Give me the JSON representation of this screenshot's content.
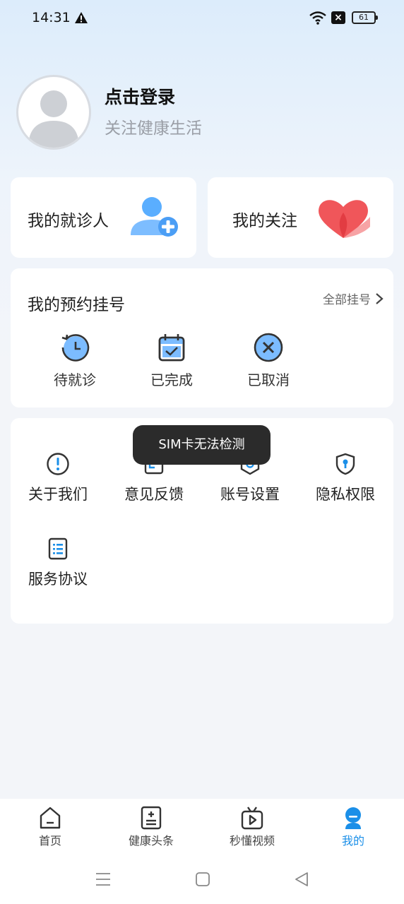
{
  "status_bar": {
    "time": "14:31",
    "battery": "61"
  },
  "profile": {
    "title": "点击登录",
    "subtitle": "关注健康生活"
  },
  "cards": {
    "patients": "我的就诊人",
    "following": "我的关注"
  },
  "appointments": {
    "title": "我的预约挂号",
    "all_label": "全部挂号",
    "items": [
      {
        "label": "待就诊",
        "icon": "clock-refresh-icon"
      },
      {
        "label": "已完成",
        "icon": "calendar-check-icon"
      },
      {
        "label": "已取消",
        "icon": "cancel-circle-icon"
      }
    ]
  },
  "menu": {
    "items": [
      {
        "label": "关于我们",
        "icon": "info-circle-icon"
      },
      {
        "label": "意见反馈",
        "icon": "feedback-icon"
      },
      {
        "label": "账号设置",
        "icon": "settings-icon"
      },
      {
        "label": "隐私权限",
        "icon": "shield-icon"
      },
      {
        "label": "服务协议",
        "icon": "document-list-icon"
      }
    ]
  },
  "toast": "SIM卡无法检测",
  "tabbar": {
    "items": [
      {
        "label": "首页",
        "icon": "home-icon"
      },
      {
        "label": "健康头条",
        "icon": "news-icon"
      },
      {
        "label": "秒懂视频",
        "icon": "tv-play-icon"
      },
      {
        "label": "我的",
        "icon": "user-icon",
        "active": true
      }
    ]
  },
  "colors": {
    "accent": "#1b8fe8",
    "heart": "#f0565a",
    "person_icon": "#5aaeff"
  }
}
